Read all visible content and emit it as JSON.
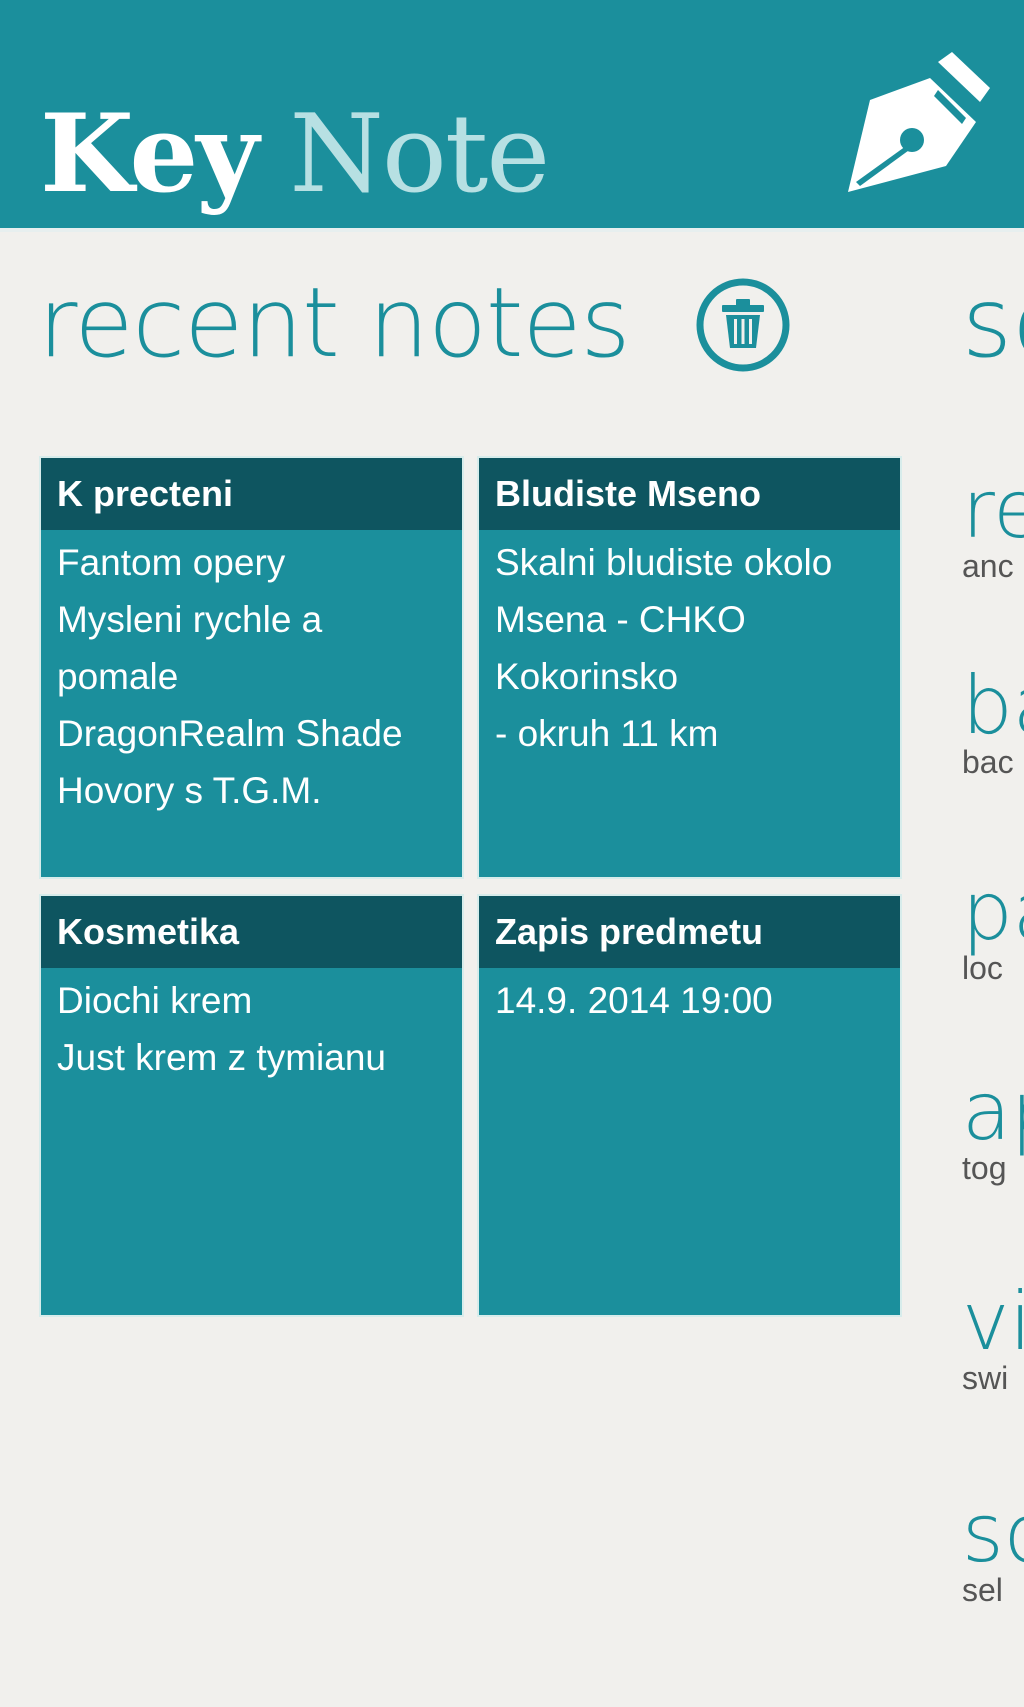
{
  "app": {
    "title_part1": "Key",
    "title_part2": "Note",
    "logo_icon": "fountain-pen-icon"
  },
  "recent": {
    "title": "recent notes",
    "delete_icon": "trash-icon",
    "notes": [
      {
        "title": "K precteni",
        "body": "Fantom opery\nMysleni rychle a pomale\nDragonRealm Shade\nHovory s T.G.M."
      },
      {
        "title": "Bludiste Mseno",
        "body": "Skalni bludiste okolo Msena - CHKO Kokorinsko\n- okruh 11 km"
      },
      {
        "title": "Kosmetika",
        "body": "Diochi krem\nJust krem z tymianu"
      },
      {
        "title": "Zapis predmetu",
        "body": "14.9. 2014 19:00"
      }
    ]
  },
  "settings": {
    "title": "se",
    "items": [
      {
        "name": "re",
        "desc": "anc"
      },
      {
        "name": "ba",
        "desc": "bac"
      },
      {
        "name": "pa",
        "desc": "loc"
      },
      {
        "name": "ap",
        "desc": "tog"
      },
      {
        "name": "vi",
        "desc": "swi"
      },
      {
        "name": "so",
        "desc": "sel"
      }
    ]
  },
  "colors": {
    "accent": "#1b8f9c",
    "tile_header": "#0e5560",
    "background": "#f1f0ed",
    "title_light": "#b7e0e3"
  }
}
